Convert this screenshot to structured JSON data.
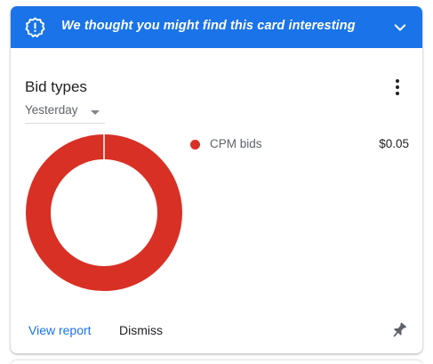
{
  "banner": {
    "text": "We thought you might find this card interesting",
    "icon": "insight-badge-icon",
    "chevron_icon": "chevron-down-icon",
    "background": "#1a73e8"
  },
  "card": {
    "title": "Bid types",
    "more_icon": "more-vert-icon",
    "date_range": {
      "selected": "Yesterday"
    },
    "footer": {
      "view_report_label": "View report",
      "dismiss_label": "Dismiss",
      "pin_icon": "pin-icon"
    }
  },
  "chart_data": {
    "type": "pie",
    "categories": [
      "CPM bids"
    ],
    "values": [
      0.05
    ],
    "value_labels": [
      "$0.05"
    ],
    "colors": [
      "#d93025"
    ],
    "legend_position": "right"
  }
}
